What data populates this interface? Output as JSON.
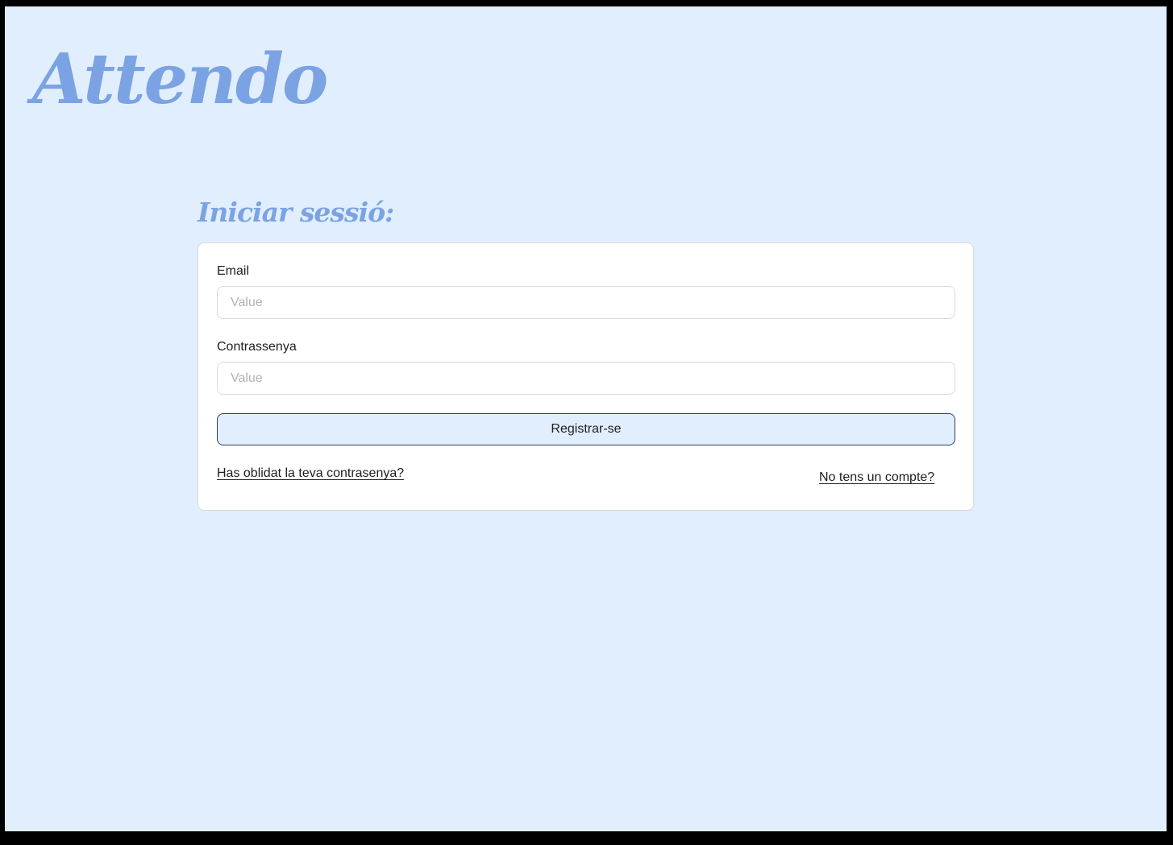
{
  "app": {
    "logo": "Attendo"
  },
  "login": {
    "title": "Iniciar sessió:",
    "email_label": "Email",
    "email_placeholder": "Value",
    "password_label": "Contrassenya",
    "password_placeholder": "Value",
    "submit_label": "Registrar-se",
    "forgot_link": "Has oblidat la teva contrasenya?",
    "signup_link": "No tens un compte?"
  },
  "colors": {
    "background": "#e0eefd",
    "accent": "#7ba3e4",
    "button_border": "#2c3e66",
    "card": "#ffffff"
  }
}
